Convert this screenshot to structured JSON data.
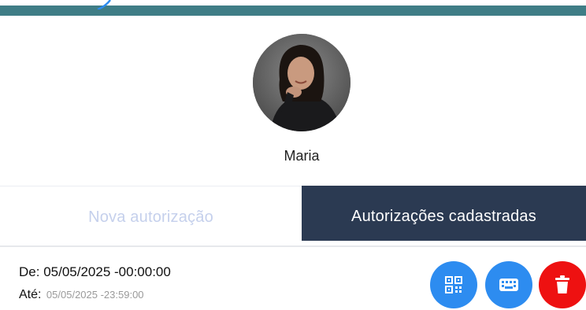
{
  "colors": {
    "header_bar": "#3f7d86",
    "tab_active_bg": "#2b3a52",
    "tab_inactive_text": "#c5d0ec",
    "action_blue": "#2d8cf0",
    "action_red": "#ee1111"
  },
  "user": {
    "name": "Maria"
  },
  "tabs": [
    {
      "label": "Nova autorização",
      "active": false
    },
    {
      "label": "Autorizações cadastradas",
      "active": true
    }
  ],
  "authorization": {
    "from_label": "De:",
    "from_value": "05/05/2025 -00:00:00",
    "until_label": "Até:",
    "until_value": "05/05/2025 -23:59:00"
  },
  "actions": [
    {
      "icon": "qr-code-icon"
    },
    {
      "icon": "keyboard-icon"
    },
    {
      "icon": "trash-icon"
    }
  ]
}
